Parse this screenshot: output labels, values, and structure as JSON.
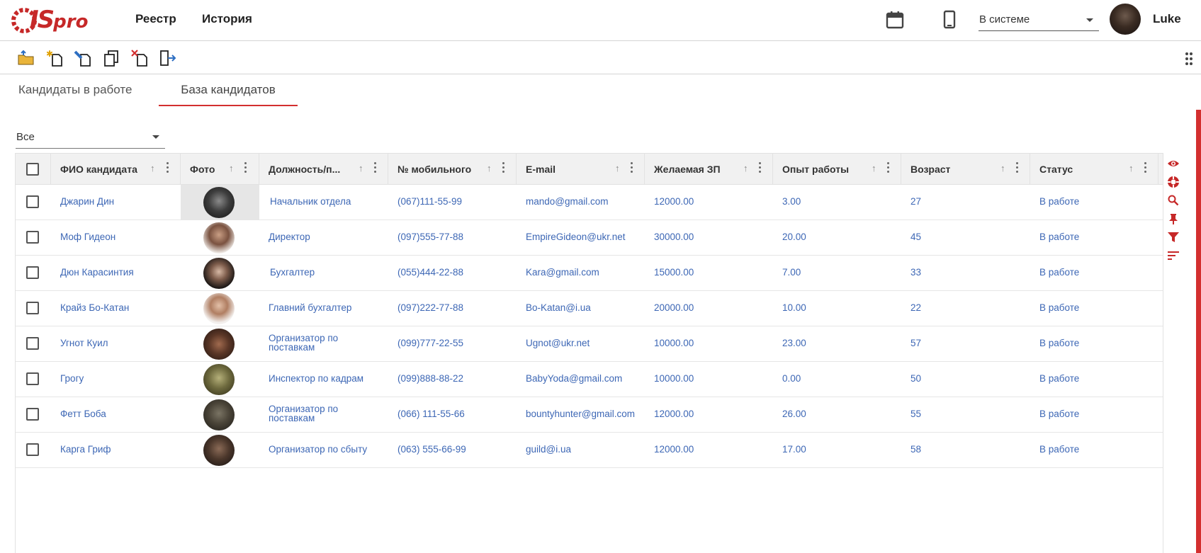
{
  "app": {
    "logo_text": "IS",
    "logo_sub": "pro"
  },
  "nav": {
    "registry": "Реестр",
    "history": "История"
  },
  "top": {
    "status_value": "В системе",
    "username": "Luke"
  },
  "icons": {
    "calendar": "calendar-icon",
    "mobile": "mobile-phone-icon",
    "open": "open-document-icon",
    "create": "create-document-icon",
    "edit": "edit-document-icon",
    "copy": "copy-document-icon",
    "delete": "delete-document-icon",
    "exit": "exit-icon",
    "more": "drag-dots-icon",
    "view": "eye-icon",
    "lifebuoy": "lifebuoy-icon",
    "search": "search-icon",
    "pin": "pin-icon",
    "filter": "filter-icon",
    "sort": "sort-lines-icon"
  },
  "colors": {
    "brand": "#c62828",
    "accent": "#d32f2f",
    "link": "#3d67b5"
  },
  "tabs": [
    {
      "label": "Кандидаты в работе"
    },
    {
      "label": "База кандидатов"
    }
  ],
  "filter": {
    "value": "Все"
  },
  "table": {
    "columns": [
      {
        "label": "ФИО кандидата"
      },
      {
        "label": "Фото"
      },
      {
        "label": "Должность/п..."
      },
      {
        "label": "№ мобильного"
      },
      {
        "label": "E-mail"
      },
      {
        "label": "Желаемая ЗП"
      },
      {
        "label": "Опыт работы"
      },
      {
        "label": "Возраст"
      },
      {
        "label": "Статус"
      }
    ],
    "sort_glyph": "↑",
    "rows": [
      {
        "name": "Джарин Дин",
        "position": "Начальник отдела",
        "phone": "(067)111-55-99",
        "email": "mando@gmail.com",
        "salary": "12000.00",
        "experience": "3.00",
        "age": "27",
        "status": "В работе"
      },
      {
        "name": "Моф Гидеон",
        "position": "Директор",
        "phone": "(097)555-77-88",
        "email": "EmpireGideon@ukr.net",
        "salary": "30000.00",
        "experience": "20.00",
        "age": "45",
        "status": "В работе"
      },
      {
        "name": "Дюн Карасинтия",
        "position": "Бухгалтер",
        "phone": "(055)444-22-88",
        "email": "Kara@gmail.com",
        "salary": "15000.00",
        "experience": "7.00",
        "age": "33",
        "status": "В работе"
      },
      {
        "name": "Крайз Бо-Катан",
        "position": "Главний бухгалтер",
        "phone": "(097)222-77-88",
        "email": "Bo-Katan@i.ua",
        "salary": "20000.00",
        "experience": "10.00",
        "age": "22",
        "status": "В работе"
      },
      {
        "name": "Угнот Куил",
        "position": "Организатор по поставкам",
        "phone": "(099)777-22-55",
        "email": "Ugnot@ukr.net",
        "salary": "10000.00",
        "experience": "23.00",
        "age": "57",
        "status": "В работе"
      },
      {
        "name": "Грогу",
        "position": "Инспектор по кадрам",
        "phone": "(099)888-88-22",
        "email": "BabyYoda@gmail.com",
        "salary": "10000.00",
        "experience": "0.00",
        "age": "50",
        "status": "В работе"
      },
      {
        "name": "Фетт Боба",
        "position": "Организатор по поставкам",
        "phone": "(066) 111-55-66",
        "email": "bountyhunter@gmail.com",
        "salary": "12000.00",
        "experience": "26.00",
        "age": "55",
        "status": "В работе"
      },
      {
        "name": "Карга Гриф",
        "position": "Организатор по сбыту",
        "phone": "(063) 555-66-99",
        "email": "guild@i.ua",
        "salary": "12000.00",
        "experience": "17.00",
        "age": "58",
        "status": "В работе"
      }
    ]
  }
}
